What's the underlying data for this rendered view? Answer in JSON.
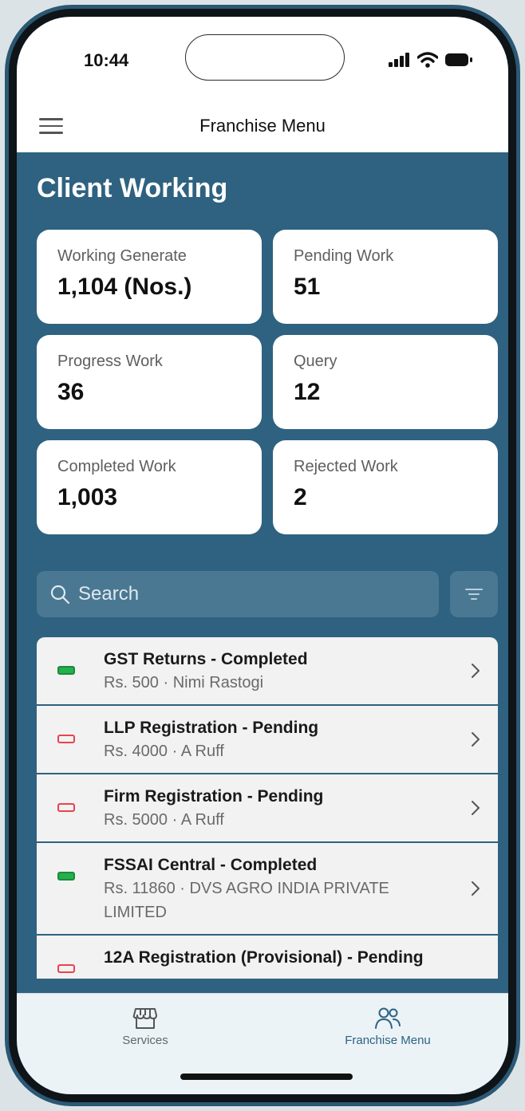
{
  "status_bar": {
    "time": "10:44",
    "icons": [
      "signal-icon",
      "wifi-icon",
      "battery-icon"
    ]
  },
  "header": {
    "menu_icon": "hamburger-menu-icon",
    "title": "Franchise Menu"
  },
  "section_title": "Client Working",
  "stats": [
    {
      "label": "Working Generate",
      "value": "1,104 (Nos.)"
    },
    {
      "label": "Pending Work",
      "value": "51"
    },
    {
      "label": "Progress Work",
      "value": "36"
    },
    {
      "label": "Query",
      "value": "12"
    },
    {
      "label": "Completed Work",
      "value": "1,003"
    },
    {
      "label": "Rejected Work",
      "value": "2"
    }
  ],
  "search": {
    "placeholder": "Search",
    "icon": "search-icon",
    "filter_icon": "filter-icon"
  },
  "list": [
    {
      "title": "GST Returns - Completed",
      "subtitle": "Rs. 500 · Nimi Rastogi",
      "status": "completed"
    },
    {
      "title": "LLP Registration  - Pending",
      "subtitle": "Rs. 4000 · A Ruff",
      "status": "pending"
    },
    {
      "title": "Firm Registration - Pending",
      "subtitle": "Rs. 5000 · A Ruff",
      "status": "pending"
    },
    {
      "title": "FSSAI Central - Completed",
      "subtitle": "Rs. 11860 · DVS AGRO INDIA PRIVATE LIMITED",
      "status": "completed"
    },
    {
      "title": "12A Registration (Provisional) - Pending",
      "subtitle": "",
      "status": "pending"
    }
  ],
  "tabs": [
    {
      "label": "Services",
      "icon": "storefront-icon",
      "active": false
    },
    {
      "label": "Franchise Menu",
      "icon": "users-icon",
      "active": true
    }
  ],
  "colors": {
    "primary": "#2e6280",
    "completed": "#22b14c",
    "pending": "#e8434f"
  }
}
